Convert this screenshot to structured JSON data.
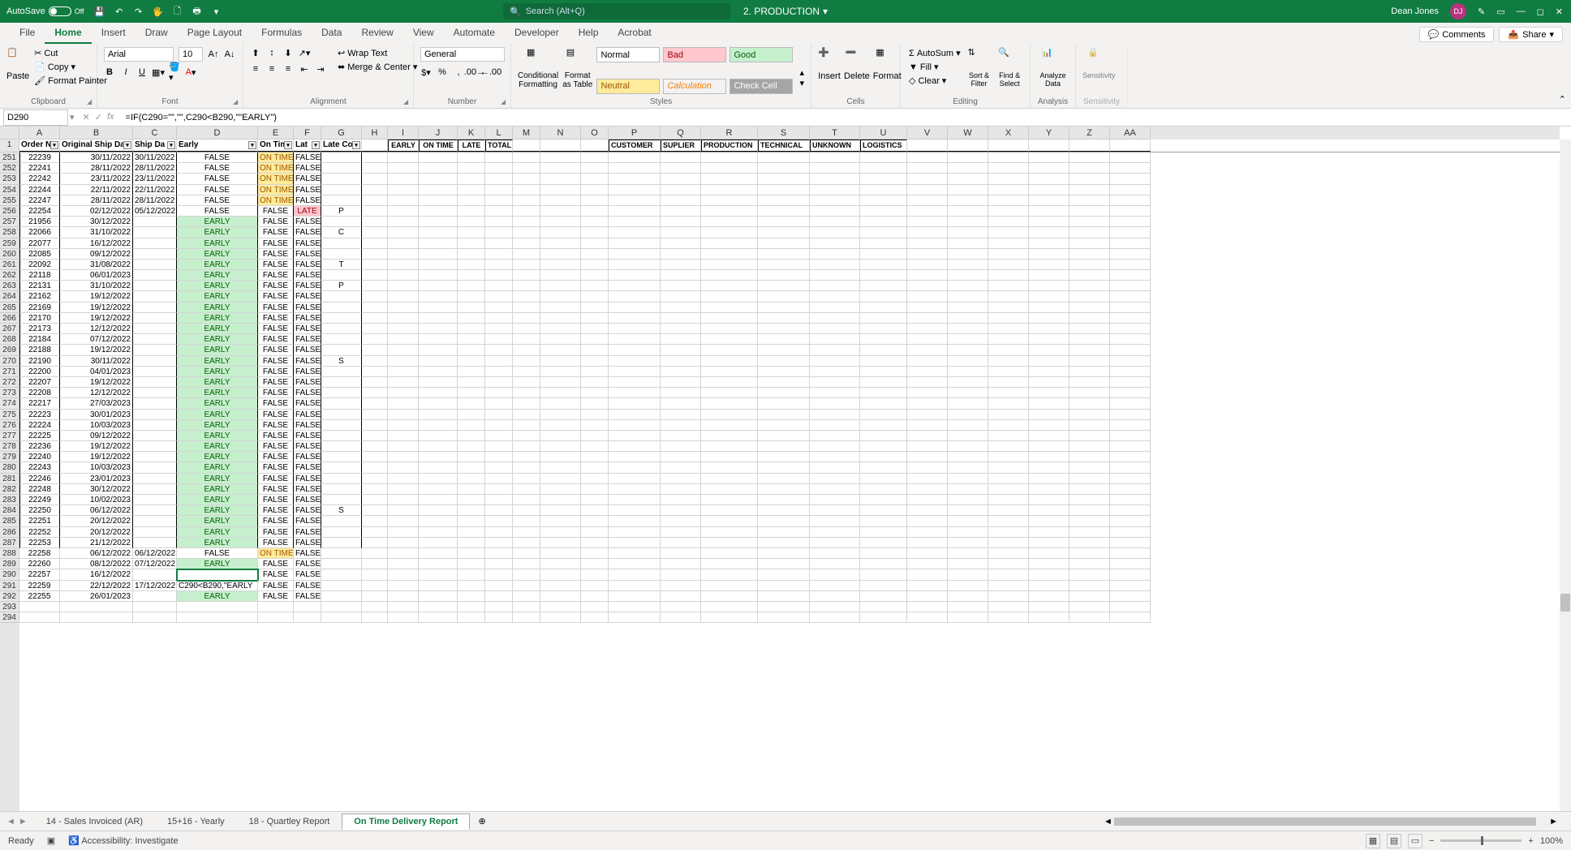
{
  "titlebar": {
    "autosave_label": "AutoSave",
    "autosave_state": "Off",
    "doc_name": "2. PRODUCTION",
    "search_placeholder": "Search (Alt+Q)",
    "user_name": "Dean Jones",
    "user_initials": "DJ"
  },
  "tabs": {
    "items": [
      "File",
      "Home",
      "Insert",
      "Draw",
      "Page Layout",
      "Formulas",
      "Data",
      "Review",
      "View",
      "Automate",
      "Developer",
      "Help",
      "Acrobat"
    ],
    "active": "Home",
    "comments": "Comments",
    "share": "Share"
  },
  "ribbon": {
    "clipboard": {
      "paste": "Paste",
      "cut": "Cut",
      "copy": "Copy",
      "fmtpainter": "Format Painter",
      "label": "Clipboard"
    },
    "font": {
      "name": "Arial",
      "size": "10",
      "label": "Font"
    },
    "alignment": {
      "wrap": "Wrap Text",
      "merge": "Merge & Center",
      "label": "Alignment"
    },
    "number": {
      "format": "General",
      "label": "Number"
    },
    "styles": {
      "cf": "Conditional Formatting",
      "fat": "Format as Table",
      "normal": "Normal",
      "bad": "Bad",
      "good": "Good",
      "neutral": "Neutral",
      "calc": "Calculation",
      "check": "Check Cell",
      "label": "Styles"
    },
    "cells": {
      "insert": "Insert",
      "delete": "Delete",
      "format": "Format",
      "label": "Cells"
    },
    "editing": {
      "autosum": "AutoSum",
      "fill": "Fill",
      "clear": "Clear",
      "sort": "Sort & Filter",
      "find": "Find & Select",
      "label": "Editing"
    },
    "analysis": {
      "analyze": "Analyze Data",
      "label": "Analysis"
    },
    "sensitivity": {
      "btn": "Sensitivity",
      "label": "Sensitivity"
    }
  },
  "formula_bar": {
    "namebox": "D290",
    "formula": "=IF(C290=\"\",\"\",C290<B290,\"\"EARLY\")"
  },
  "columns": {
    "letters": [
      "A",
      "B",
      "C",
      "D",
      "E",
      "F",
      "G",
      "H",
      "I",
      "J",
      "K",
      "L",
      "M",
      "N",
      "O",
      "P",
      "Q",
      "R",
      "S",
      "T",
      "U",
      "V",
      "W",
      "X",
      "Y",
      "Z",
      "AA"
    ],
    "widths": [
      50,
      90,
      54,
      100,
      44,
      34,
      50,
      32,
      38,
      48,
      34,
      34,
      34,
      50,
      34,
      64,
      50,
      70,
      64,
      62,
      58,
      50,
      50,
      50,
      50,
      50,
      50
    ]
  },
  "frozen_headers": {
    "A": "Order N",
    "B": "Original Ship Da",
    "C": "Ship Da",
    "D": "Early",
    "E": "On Tim",
    "F": "Lat",
    "G": "Late Co",
    "I": "EARLY",
    "J": "ON TIME",
    "K": "LATE",
    "L": "TOTAL",
    "P": "CUSTOMER",
    "Q": "SUPLIER",
    "R": "PRODUCTION",
    "S": "TECHNICAL",
    "T": "UNKNOWN",
    "U": "LOGISTICS"
  },
  "rows": [
    {
      "r": 251,
      "A": "22239",
      "B": "30/11/2022",
      "C": "30/11/2022",
      "D": "FALSE",
      "Dcls": "c-center",
      "E": "ON TIME",
      "Ecls": "c-ontime",
      "F": "FALSE",
      "G": ""
    },
    {
      "r": 252,
      "A": "22241",
      "B": "28/11/2022",
      "C": "28/11/2022",
      "D": "FALSE",
      "Dcls": "c-center",
      "E": "ON TIME",
      "Ecls": "c-ontime",
      "F": "FALSE",
      "G": ""
    },
    {
      "r": 253,
      "A": "22242",
      "B": "23/11/2022",
      "C": "23/11/2022",
      "D": "FALSE",
      "Dcls": "c-center",
      "E": "ON TIME",
      "Ecls": "c-ontime",
      "F": "FALSE",
      "G": ""
    },
    {
      "r": 254,
      "A": "22244",
      "B": "22/11/2022",
      "C": "22/11/2022",
      "D": "FALSE",
      "Dcls": "c-center",
      "E": "ON TIME",
      "Ecls": "c-ontime",
      "F": "FALSE",
      "G": ""
    },
    {
      "r": 255,
      "A": "22247",
      "B": "28/11/2022",
      "C": "28/11/2022",
      "D": "FALSE",
      "Dcls": "c-center",
      "E": "ON TIME",
      "Ecls": "c-ontime",
      "F": "FALSE",
      "G": ""
    },
    {
      "r": 256,
      "A": "22254",
      "B": "02/12/2022",
      "C": "05/12/2022",
      "D": "FALSE",
      "Dcls": "c-center",
      "E": "FALSE",
      "Ecls": "c-center",
      "F": "LATE",
      "Fcls": "c-late",
      "G": "P"
    },
    {
      "r": 257,
      "A": "21956",
      "B": "30/12/2022",
      "C": "",
      "D": "EARLY",
      "Dcls": "c-early",
      "E": "FALSE",
      "Ecls": "c-center",
      "F": "FALSE",
      "G": ""
    },
    {
      "r": 258,
      "A": "22066",
      "B": "31/10/2022",
      "C": "",
      "D": "EARLY",
      "Dcls": "c-early",
      "E": "FALSE",
      "Ecls": "c-center",
      "F": "FALSE",
      "G": "C"
    },
    {
      "r": 259,
      "A": "22077",
      "B": "16/12/2022",
      "C": "",
      "D": "EARLY",
      "Dcls": "c-early",
      "E": "FALSE",
      "Ecls": "c-center",
      "F": "FALSE",
      "G": ""
    },
    {
      "r": 260,
      "A": "22085",
      "B": "09/12/2022",
      "C": "",
      "D": "EARLY",
      "Dcls": "c-early",
      "E": "FALSE",
      "Ecls": "c-center",
      "F": "FALSE",
      "G": ""
    },
    {
      "r": 261,
      "A": "22092",
      "B": "31/08/2022",
      "C": "",
      "D": "EARLY",
      "Dcls": "c-early",
      "E": "FALSE",
      "Ecls": "c-center",
      "F": "FALSE",
      "G": "T"
    },
    {
      "r": 262,
      "A": "22118",
      "B": "06/01/2023",
      "C": "",
      "D": "EARLY",
      "Dcls": "c-early",
      "E": "FALSE",
      "Ecls": "c-center",
      "F": "FALSE",
      "G": ""
    },
    {
      "r": 263,
      "A": "22131",
      "B": "31/10/2022",
      "C": "",
      "D": "EARLY",
      "Dcls": "c-early",
      "E": "FALSE",
      "Ecls": "c-center",
      "F": "FALSE",
      "G": "P"
    },
    {
      "r": 264,
      "A": "22162",
      "B": "19/12/2022",
      "C": "",
      "D": "EARLY",
      "Dcls": "c-early",
      "E": "FALSE",
      "Ecls": "c-center",
      "F": "FALSE",
      "G": ""
    },
    {
      "r": 265,
      "A": "22169",
      "B": "19/12/2022",
      "C": "",
      "D": "EARLY",
      "Dcls": "c-early",
      "E": "FALSE",
      "Ecls": "c-center",
      "F": "FALSE",
      "G": ""
    },
    {
      "r": 266,
      "A": "22170",
      "B": "19/12/2022",
      "C": "",
      "D": "EARLY",
      "Dcls": "c-early",
      "E": "FALSE",
      "Ecls": "c-center",
      "F": "FALSE",
      "G": ""
    },
    {
      "r": 267,
      "A": "22173",
      "B": "12/12/2022",
      "C": "",
      "D": "EARLY",
      "Dcls": "c-early",
      "E": "FALSE",
      "Ecls": "c-center",
      "F": "FALSE",
      "G": ""
    },
    {
      "r": 268,
      "A": "22184",
      "B": "07/12/2022",
      "C": "",
      "D": "EARLY",
      "Dcls": "c-early",
      "E": "FALSE",
      "Ecls": "c-center",
      "F": "FALSE",
      "G": ""
    },
    {
      "r": 269,
      "A": "22188",
      "B": "19/12/2022",
      "C": "",
      "D": "EARLY",
      "Dcls": "c-early",
      "E": "FALSE",
      "Ecls": "c-center",
      "F": "FALSE",
      "G": ""
    },
    {
      "r": 270,
      "A": "22190",
      "B": "30/11/2022",
      "C": "",
      "D": "EARLY",
      "Dcls": "c-early",
      "E": "FALSE",
      "Ecls": "c-center",
      "F": "FALSE",
      "G": "S"
    },
    {
      "r": 271,
      "A": "22200",
      "B": "04/01/2023",
      "C": "",
      "D": "EARLY",
      "Dcls": "c-early",
      "E": "FALSE",
      "Ecls": "c-center",
      "F": "FALSE",
      "G": ""
    },
    {
      "r": 272,
      "A": "22207",
      "B": "19/12/2022",
      "C": "",
      "D": "EARLY",
      "Dcls": "c-early",
      "E": "FALSE",
      "Ecls": "c-center",
      "F": "FALSE",
      "G": ""
    },
    {
      "r": 273,
      "A": "22208",
      "B": "12/12/2022",
      "C": "",
      "D": "EARLY",
      "Dcls": "c-early",
      "E": "FALSE",
      "Ecls": "c-center",
      "F": "FALSE",
      "G": ""
    },
    {
      "r": 274,
      "A": "22217",
      "B": "27/03/2023",
      "C": "",
      "D": "EARLY",
      "Dcls": "c-early",
      "E": "FALSE",
      "Ecls": "c-center",
      "F": "FALSE",
      "G": ""
    },
    {
      "r": 275,
      "A": "22223",
      "B": "30/01/2023",
      "C": "",
      "D": "EARLY",
      "Dcls": "c-early",
      "E": "FALSE",
      "Ecls": "c-center",
      "F": "FALSE",
      "G": ""
    },
    {
      "r": 276,
      "A": "22224",
      "B": "10/03/2023",
      "C": "",
      "D": "EARLY",
      "Dcls": "c-early",
      "E": "FALSE",
      "Ecls": "c-center",
      "F": "FALSE",
      "G": ""
    },
    {
      "r": 277,
      "A": "22225",
      "B": "09/12/2022",
      "C": "",
      "D": "EARLY",
      "Dcls": "c-early",
      "E": "FALSE",
      "Ecls": "c-center",
      "F": "FALSE",
      "G": ""
    },
    {
      "r": 278,
      "A": "22236",
      "B": "19/12/2022",
      "C": "",
      "D": "EARLY",
      "Dcls": "c-early",
      "E": "FALSE",
      "Ecls": "c-center",
      "F": "FALSE",
      "G": ""
    },
    {
      "r": 279,
      "A": "22240",
      "B": "19/12/2022",
      "C": "",
      "D": "EARLY",
      "Dcls": "c-early",
      "E": "FALSE",
      "Ecls": "c-center",
      "F": "FALSE",
      "G": ""
    },
    {
      "r": 280,
      "A": "22243",
      "B": "10/03/2023",
      "C": "",
      "D": "EARLY",
      "Dcls": "c-early",
      "E": "FALSE",
      "Ecls": "c-center",
      "F": "FALSE",
      "G": ""
    },
    {
      "r": 281,
      "A": "22246",
      "B": "23/01/2023",
      "C": "",
      "D": "EARLY",
      "Dcls": "c-early",
      "E": "FALSE",
      "Ecls": "c-center",
      "F": "FALSE",
      "G": ""
    },
    {
      "r": 282,
      "A": "22248",
      "B": "30/12/2022",
      "C": "",
      "D": "EARLY",
      "Dcls": "c-early",
      "E": "FALSE",
      "Ecls": "c-center",
      "F": "FALSE",
      "G": ""
    },
    {
      "r": 283,
      "A": "22249",
      "B": "10/02/2023",
      "C": "",
      "D": "EARLY",
      "Dcls": "c-early",
      "E": "FALSE",
      "Ecls": "c-center",
      "F": "FALSE",
      "G": ""
    },
    {
      "r": 284,
      "A": "22250",
      "B": "06/12/2022",
      "C": "",
      "D": "EARLY",
      "Dcls": "c-early",
      "E": "FALSE",
      "Ecls": "c-center",
      "F": "FALSE",
      "G": "S"
    },
    {
      "r": 285,
      "A": "22251",
      "B": "20/12/2022",
      "C": "",
      "D": "EARLY",
      "Dcls": "c-early",
      "E": "FALSE",
      "Ecls": "c-center",
      "F": "FALSE",
      "G": ""
    },
    {
      "r": 286,
      "A": "22252",
      "B": "20/12/2022",
      "C": "",
      "D": "EARLY",
      "Dcls": "c-early",
      "E": "FALSE",
      "Ecls": "c-center",
      "F": "FALSE",
      "G": ""
    },
    {
      "r": 287,
      "A": "22253",
      "B": "21/12/2022",
      "C": "",
      "D": "EARLY",
      "Dcls": "c-early",
      "E": "FALSE",
      "Ecls": "c-center",
      "F": "FALSE",
      "G": ""
    },
    {
      "r": 288,
      "A": "22258",
      "B": "06/12/2022",
      "C": "06/12/2022",
      "D": "FALSE",
      "Dcls": "c-center",
      "E": "ON TIME",
      "Ecls": "c-ontime",
      "F": "FALSE",
      "G": ""
    },
    {
      "r": 289,
      "A": "22260",
      "B": "08/12/2022",
      "C": "07/12/2022",
      "D": "EARLY",
      "Dcls": "c-early",
      "E": "FALSE",
      "Ecls": "c-center",
      "F": "FALSE",
      "G": ""
    },
    {
      "r": 290,
      "A": "22257",
      "B": "16/12/2022",
      "C": "",
      "D": "",
      "Dcls": "active-cell",
      "E": "FALSE",
      "Ecls": "c-center",
      "F": "FALSE",
      "G": ""
    },
    {
      "r": 291,
      "A": "22259",
      "B": "22/12/2022",
      "C": "17/12/2022",
      "D": "C290<B290,\"EARLY",
      "Dcls": "",
      "E": "FALSE",
      "Ecls": "c-center",
      "F": "FALSE",
      "G": ""
    },
    {
      "r": 292,
      "A": "22255",
      "B": "26/01/2023",
      "C": "",
      "D": "EARLY",
      "Dcls": "c-early",
      "E": "FALSE",
      "Ecls": "c-center",
      "F": "FALSE",
      "G": ""
    },
    {
      "r": 293,
      "A": "",
      "B": "",
      "C": "",
      "D": "",
      "E": "",
      "F": "",
      "G": ""
    },
    {
      "r": 294,
      "A": "",
      "B": "",
      "C": "",
      "D": "",
      "E": "",
      "F": "",
      "G": ""
    }
  ],
  "sheet_tabs": {
    "items": [
      "14 - Sales Invoiced (AR)",
      "15+16 - Yearly",
      "18 - Quartley Report",
      "On Time Delivery Report"
    ],
    "active": "On Time Delivery Report"
  },
  "statusbar": {
    "ready": "Ready",
    "accessibility": "Accessibility: Investigate",
    "zoom": "100%"
  }
}
